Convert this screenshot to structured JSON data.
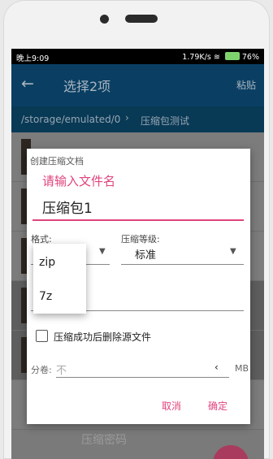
{
  "status_bar": {
    "time": "晚上9:09",
    "speed": "1.79K/s",
    "battery": "76%"
  },
  "app_bar": {
    "title": "选择2项",
    "paste_label": "粘贴"
  },
  "path_bar": {
    "path": "/storage/emulated/0",
    "current_folder": "压缩包测试"
  },
  "dialog": {
    "title": "创建压缩文档",
    "name_label": "请输入文件名",
    "name_value": "压缩包1",
    "format_label": "格式:",
    "level_label": "压缩等级:",
    "level_value": "标准",
    "password_placeholder": "压缩密码",
    "delete_source_label": "压缩成功后删除源文件",
    "delete_source_checked": false,
    "split_label": "分卷:",
    "split_value": "不",
    "split_unit": "MB",
    "cancel_label": "取消",
    "ok_label": "确定"
  },
  "format_dropdown": {
    "options": [
      "zip",
      "7z"
    ]
  },
  "colors": {
    "accent": "#e0447e",
    "app_bar": "#0a3f63"
  }
}
